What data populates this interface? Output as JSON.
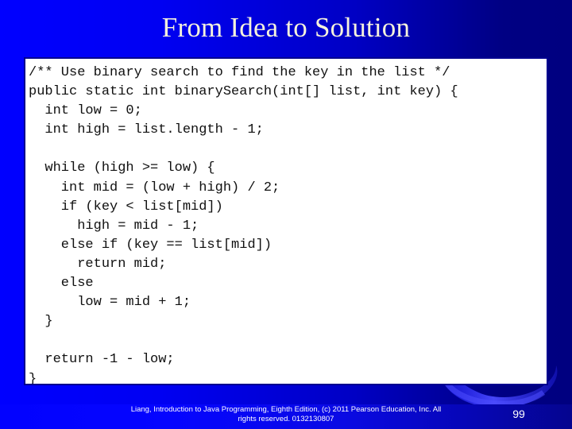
{
  "slide": {
    "title": "From Idea to Solution",
    "page_number": "99",
    "background_left_color": "#0000ff",
    "background_right_color": "#000080",
    "title_color": "#f6f2dc"
  },
  "code_block": {
    "language": "java",
    "background_color": "#ffffff",
    "border_color": "#00008f",
    "text_color": "#101010",
    "lines": [
      "/** Use binary search to find the key in the list */",
      "public static int binarySearch(int[] list, int key) {",
      "  int low = 0;",
      "  int high = list.length - 1;",
      "",
      "  while (high >= low) {",
      "    int mid = (low + high) / 2;",
      "    if (key < list[mid])",
      "      high = mid - 1;",
      "    else if (key == list[mid])",
      "      return mid;",
      "    else",
      "      low = mid + 1;",
      "  }",
      "",
      "  return -1 - low;",
      "}"
    ]
  },
  "footer": {
    "line1": "Liang, Introduction to Java Programming, Eighth Edition, (c) 2011 Pearson Education, Inc. All",
    "line2": "rights reserved. 0132130807",
    "text_color": "#ffffff"
  },
  "decoration": {
    "swoosh_name": "blue-crescent-swoosh",
    "swoosh_color": "#1a1aff"
  }
}
